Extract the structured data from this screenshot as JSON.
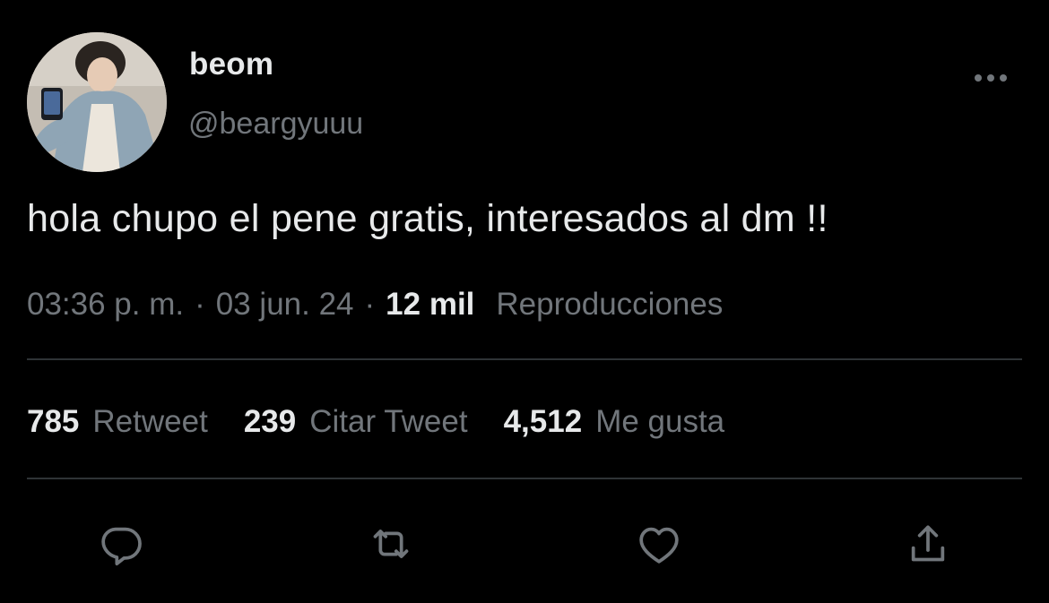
{
  "user": {
    "display_name": "beom",
    "handle": "@beargyuuu"
  },
  "tweet": {
    "text": "hola chupo el pene gratis, interesados al dm !!",
    "time": "03:36 p. m.",
    "separator": "·",
    "date": "03 jun. 24",
    "views_count": "12 mil",
    "views_label": "Reproducciones"
  },
  "stats": {
    "retweets": {
      "count": "785",
      "label": "Retweet"
    },
    "quotes": {
      "count": "239",
      "label": "Citar Tweet"
    },
    "likes": {
      "count": "4,512",
      "label": "Me gusta"
    }
  },
  "icons": {
    "more": "more-horizontal-icon",
    "reply": "reply-icon",
    "retweet": "retweet-icon",
    "like": "heart-icon",
    "share": "share-icon"
  },
  "colors": {
    "background": "#000000",
    "primary_text": "#e7e9ea",
    "secondary_text": "#71767b",
    "divider": "#2f3336"
  }
}
